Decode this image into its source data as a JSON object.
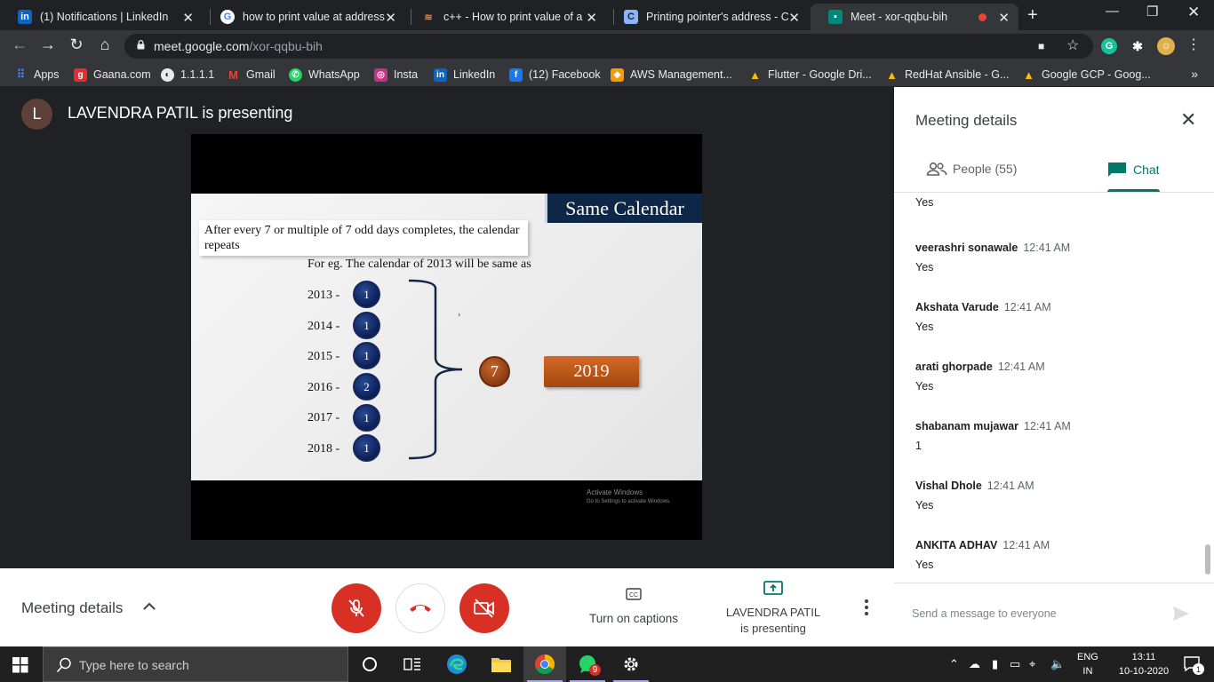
{
  "browser": {
    "tabs": [
      {
        "title": "(1) Notifications | LinkedIn",
        "icon": "linkedin-icon",
        "color": "#0a66c2"
      },
      {
        "title": "how to print value at address i",
        "icon": "google-icon",
        "color": "#ffffff"
      },
      {
        "title": "c++ - How to print value of a V",
        "icon": "stackoverflow-icon",
        "color": "#f48024"
      },
      {
        "title": "Printing pointer's address - C+",
        "icon": "cplusplus-icon",
        "color": "#8ab4f8"
      },
      {
        "title": "Meet - xor-qqbu-bih",
        "icon": "meet-icon",
        "color": "#00897b"
      }
    ],
    "url_host": "meet.google.com",
    "url_path": "/xor-qqbu-bih",
    "bookmarks": [
      {
        "label": "Apps",
        "icon": "apps-grid-icon",
        "color": "#4285f4"
      },
      {
        "label": "Gaana.com",
        "icon": "gaana-icon",
        "color": "#e72c30"
      },
      {
        "label": "1.1.1.1",
        "icon": "globe-icon",
        "color": "#e8eaed"
      },
      {
        "label": "Gmail",
        "icon": "gmail-icon",
        "color": "#ea4335"
      },
      {
        "label": "WhatsApp",
        "icon": "whatsapp-icon",
        "color": "#25d366"
      },
      {
        "label": "Insta",
        "icon": "instagram-icon",
        "color": "#c13584"
      },
      {
        "label": "LinkedIn",
        "icon": "linkedin-icon",
        "color": "#0a66c2"
      },
      {
        "label": "(12) Facebook",
        "icon": "facebook-icon",
        "color": "#1877f2"
      },
      {
        "label": "AWS Management...",
        "icon": "aws-icon",
        "color": "#ff9900"
      },
      {
        "label": "Flutter - Google Dri...",
        "icon": "drive-icon",
        "color": "#fbbc04"
      },
      {
        "label": "RedHat Ansible - G...",
        "icon": "drive-icon",
        "color": "#fbbc04"
      },
      {
        "label": "Google GCP - Goog...",
        "icon": "drive-icon",
        "color": "#fbbc04"
      }
    ]
  },
  "meet": {
    "presenter_initial": "L",
    "presenter_title": "LAVENDRA PATIL is presenting",
    "slide": {
      "title": "Same Calendar",
      "note": "After every 7 or multiple of 7 odd days completes, the calendar repeats",
      "example": "For eg. The calendar of 2013 will be same as",
      "years": [
        {
          "year": "2013 -",
          "odd_days": "1"
        },
        {
          "year": "2014 -",
          "odd_days": "1"
        },
        {
          "year": "2015 -",
          "odd_days": "1"
        },
        {
          "year": "2016 -",
          "odd_days": "2"
        },
        {
          "year": "2017 -",
          "odd_days": "1"
        },
        {
          "year": "2018 -",
          "odd_days": "1"
        }
      ],
      "total": "7",
      "result_year": "2019",
      "watermark_title": "Activate Windows",
      "watermark_sub": "Go to Settings to activate Windows."
    },
    "controls": {
      "details_label": "Meeting details",
      "captions_label": "Turn on captions",
      "present_line1": "LAVENDRA PATIL",
      "present_line2": "is presenting"
    },
    "panel": {
      "title": "Meeting details",
      "people_tab": "People (55)",
      "chat_tab": "Chat",
      "messages": [
        {
          "author": "",
          "time": "",
          "text": "Yes"
        },
        {
          "author": "veerashri sonawale",
          "time": "12:41 AM",
          "text": "Yes"
        },
        {
          "author": "Akshata Varude",
          "time": "12:41 AM",
          "text": "Yes"
        },
        {
          "author": "arati ghorpade",
          "time": "12:41 AM",
          "text": "Yes"
        },
        {
          "author": "shabanam mujawar",
          "time": "12:41 AM",
          "text": "1"
        },
        {
          "author": "Vishal Dhole",
          "time": "12:41 AM",
          "text": "Yes"
        },
        {
          "author": "ANKITA ADHAV",
          "time": "12:41 AM",
          "text": "Yes"
        }
      ],
      "input_placeholder": "Send a message to everyone"
    }
  },
  "taskbar": {
    "search_placeholder": "Type here to search",
    "whatsapp_badge": "9",
    "lang_line1": "ENG",
    "lang_line2": "IN",
    "time": "13:11",
    "date": "10-10-2020",
    "notification_count": "1"
  }
}
